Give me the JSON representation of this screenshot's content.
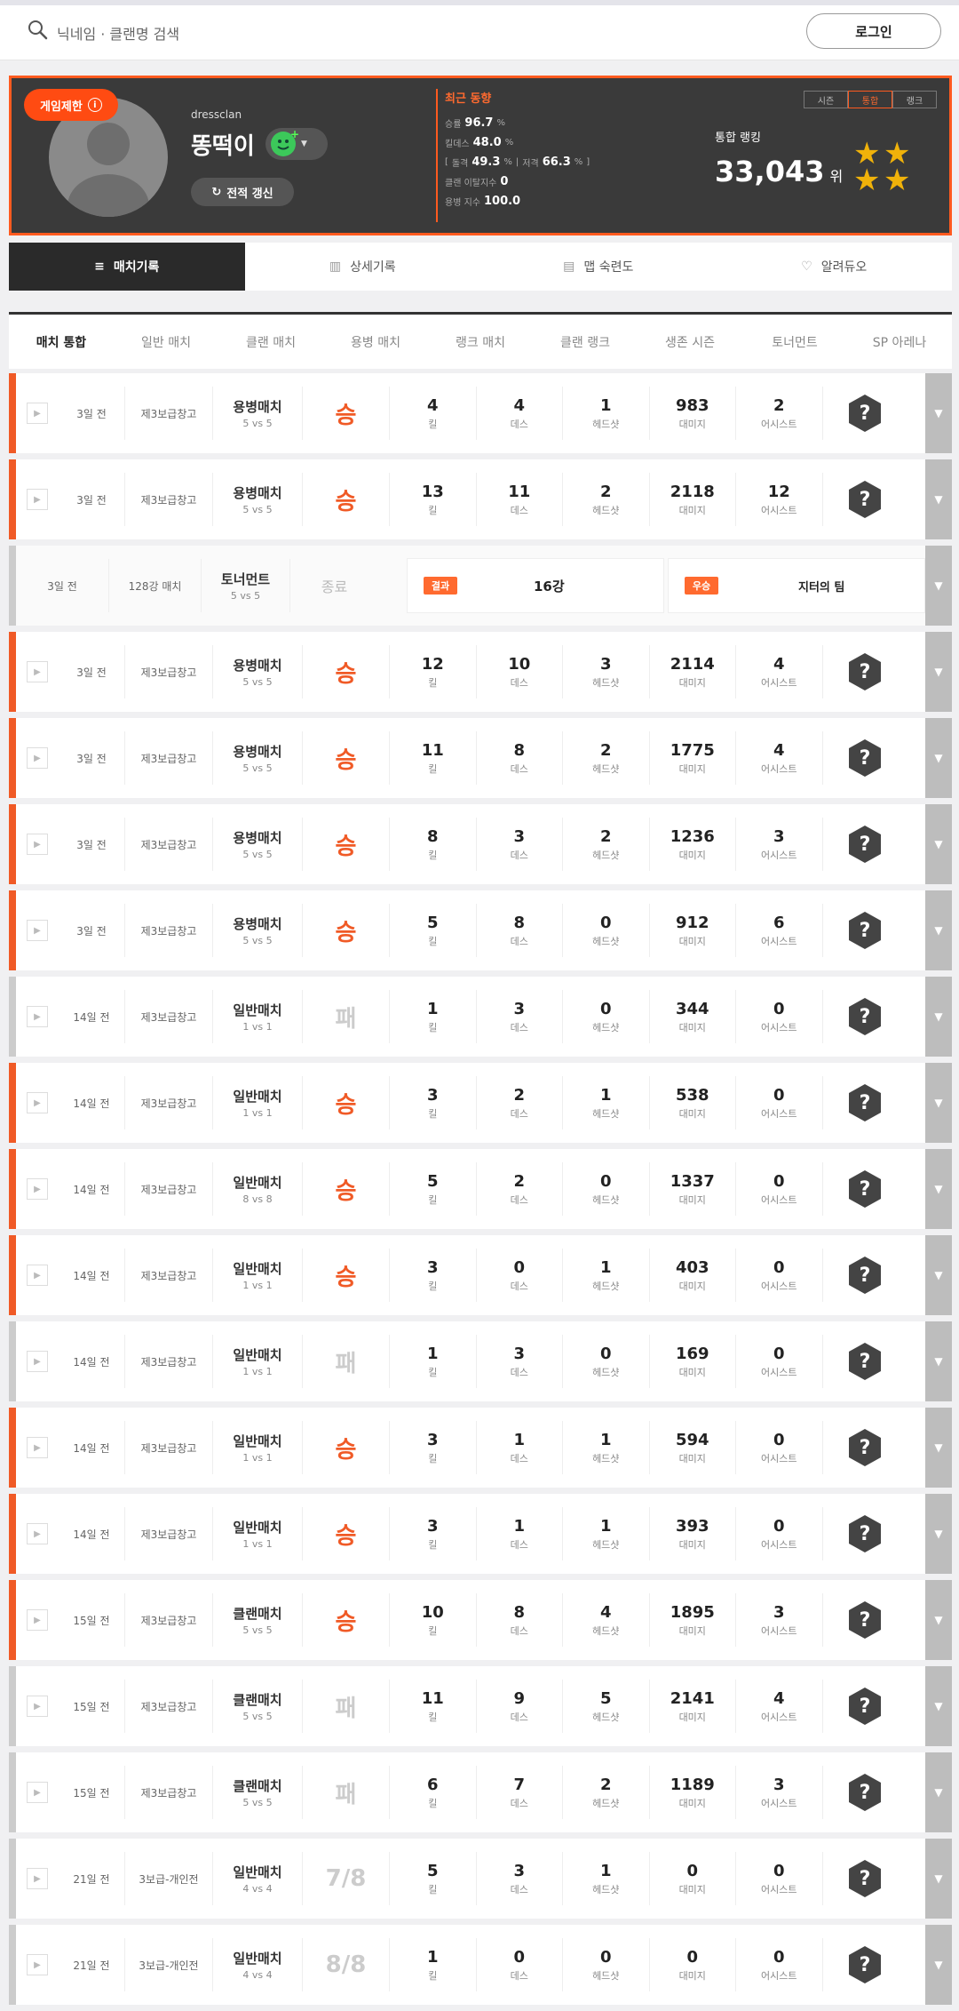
{
  "search": {
    "placeholder": "닉네임 · 클랜명 검색",
    "login_label": "로그인"
  },
  "profile": {
    "restrict_label": "게임제한",
    "clan": "dressclan",
    "nickname": "똥떡이",
    "refresh_label": "전적 갱신",
    "trend_title": "최근 동향",
    "trend": {
      "winrate_label": "승률",
      "winrate": "96.7",
      "pct": "%",
      "kd_label": "킬데스",
      "kd": "48.0",
      "headshot_label": "돌격",
      "headshot": "49.3",
      "sniper_label": "저격",
      "sniper": "66.3",
      "clan_leave_label": "클랜 이탈지수",
      "clan_leave": "0",
      "merc_label": "용병 지수",
      "merc": "100.0"
    },
    "scope_tabs": [
      "시즌",
      "통합",
      "랭크"
    ],
    "rank_label": "통합 랭킹",
    "rank_value": "33,043",
    "rank_unit": "위"
  },
  "nav_tabs": [
    {
      "label": "매치기록",
      "icon": "list-icon"
    },
    {
      "label": "상세기록",
      "icon": "chart-icon"
    },
    {
      "label": "맵 숙련도",
      "icon": "map-icon"
    },
    {
      "label": "알려듀오",
      "icon": "heart-icon"
    }
  ],
  "filters": [
    "매치 통합",
    "일반 매치",
    "클랜 매치",
    "용병 매치",
    "랭크 매치",
    "클랜 랭크",
    "생존 시즌",
    "토너먼트",
    "SP 아레나"
  ],
  "stat_labels": {
    "kill": "킬",
    "death": "데스",
    "headshot": "헤드샷",
    "damage": "대미지",
    "assist": "어시스트"
  },
  "tournament": {
    "time": "3일 전",
    "round": "128강 매치",
    "type": "토너먼트",
    "mode": "5 vs 5",
    "status": "종료",
    "result_badge": "결과",
    "result_value": "16강",
    "win_badge": "우승",
    "winner": "지터의 팀"
  },
  "matches": [
    {
      "time": "3일 전",
      "map": "제3보급창고",
      "type": "용병매치",
      "mode": "5 vs 5",
      "result": "승",
      "win": true,
      "k": "4",
      "d": "4",
      "hs": "1",
      "dmg": "983",
      "as": "2"
    },
    {
      "time": "3일 전",
      "map": "제3보급창고",
      "type": "용병매치",
      "mode": "5 vs 5",
      "result": "승",
      "win": true,
      "k": "13",
      "d": "11",
      "hs": "2",
      "dmg": "2118",
      "as": "12"
    },
    {
      "time": "3일 전",
      "map": "제3보급창고",
      "type": "용병매치",
      "mode": "5 vs 5",
      "result": "승",
      "win": true,
      "k": "12",
      "d": "10",
      "hs": "3",
      "dmg": "2114",
      "as": "4"
    },
    {
      "time": "3일 전",
      "map": "제3보급창고",
      "type": "용병매치",
      "mode": "5 vs 5",
      "result": "승",
      "win": true,
      "k": "11",
      "d": "8",
      "hs": "2",
      "dmg": "1775",
      "as": "4"
    },
    {
      "time": "3일 전",
      "map": "제3보급창고",
      "type": "용병매치",
      "mode": "5 vs 5",
      "result": "승",
      "win": true,
      "k": "8",
      "d": "3",
      "hs": "2",
      "dmg": "1236",
      "as": "3"
    },
    {
      "time": "3일 전",
      "map": "제3보급창고",
      "type": "용병매치",
      "mode": "5 vs 5",
      "result": "승",
      "win": true,
      "k": "5",
      "d": "8",
      "hs": "0",
      "dmg": "912",
      "as": "6"
    },
    {
      "time": "14일 전",
      "map": "제3보급창고",
      "type": "일반매치",
      "mode": "1 vs 1",
      "result": "패",
      "win": false,
      "k": "1",
      "d": "3",
      "hs": "0",
      "dmg": "344",
      "as": "0"
    },
    {
      "time": "14일 전",
      "map": "제3보급창고",
      "type": "일반매치",
      "mode": "1 vs 1",
      "result": "승",
      "win": true,
      "k": "3",
      "d": "2",
      "hs": "1",
      "dmg": "538",
      "as": "0"
    },
    {
      "time": "14일 전",
      "map": "제3보급창고",
      "type": "일반매치",
      "mode": "8 vs 8",
      "result": "승",
      "win": true,
      "k": "5",
      "d": "2",
      "hs": "0",
      "dmg": "1337",
      "as": "0"
    },
    {
      "time": "14일 전",
      "map": "제3보급창고",
      "type": "일반매치",
      "mode": "1 vs 1",
      "result": "승",
      "win": true,
      "k": "3",
      "d": "0",
      "hs": "1",
      "dmg": "403",
      "as": "0"
    },
    {
      "time": "14일 전",
      "map": "제3보급창고",
      "type": "일반매치",
      "mode": "1 vs 1",
      "result": "패",
      "win": false,
      "k": "1",
      "d": "3",
      "hs": "0",
      "dmg": "169",
      "as": "0"
    },
    {
      "time": "14일 전",
      "map": "제3보급창고",
      "type": "일반매치",
      "mode": "1 vs 1",
      "result": "승",
      "win": true,
      "k": "3",
      "d": "1",
      "hs": "1",
      "dmg": "594",
      "as": "0"
    },
    {
      "time": "14일 전",
      "map": "제3보급창고",
      "type": "일반매치",
      "mode": "1 vs 1",
      "result": "승",
      "win": true,
      "k": "3",
      "d": "1",
      "hs": "1",
      "dmg": "393",
      "as": "0"
    },
    {
      "time": "15일 전",
      "map": "제3보급창고",
      "type": "클랜매치",
      "mode": "5 vs 5",
      "result": "승",
      "win": true,
      "k": "10",
      "d": "8",
      "hs": "4",
      "dmg": "1895",
      "as": "3"
    },
    {
      "time": "15일 전",
      "map": "제3보급창고",
      "type": "클랜매치",
      "mode": "5 vs 5",
      "result": "패",
      "win": false,
      "k": "11",
      "d": "9",
      "hs": "5",
      "dmg": "2141",
      "as": "4"
    },
    {
      "time": "15일 전",
      "map": "제3보급창고",
      "type": "클랜매치",
      "mode": "5 vs 5",
      "result": "패",
      "win": false,
      "k": "6",
      "d": "7",
      "hs": "2",
      "dmg": "1189",
      "as": "3"
    },
    {
      "time": "21일 전",
      "map": "3보급-개인전",
      "type": "일반매치",
      "mode": "4 vs 4",
      "result": "7/8",
      "win": false,
      "k": "5",
      "d": "3",
      "hs": "1",
      "dmg": "0",
      "as": "0"
    },
    {
      "time": "21일 전",
      "map": "3보급-개인전",
      "type": "일반매치",
      "mode": "4 vs 4",
      "result": "8/8",
      "win": false,
      "k": "1",
      "d": "0",
      "hs": "0",
      "dmg": "0",
      "as": "0"
    }
  ],
  "colors": {
    "accent": "#f05a26",
    "loss": "#cccccc"
  }
}
